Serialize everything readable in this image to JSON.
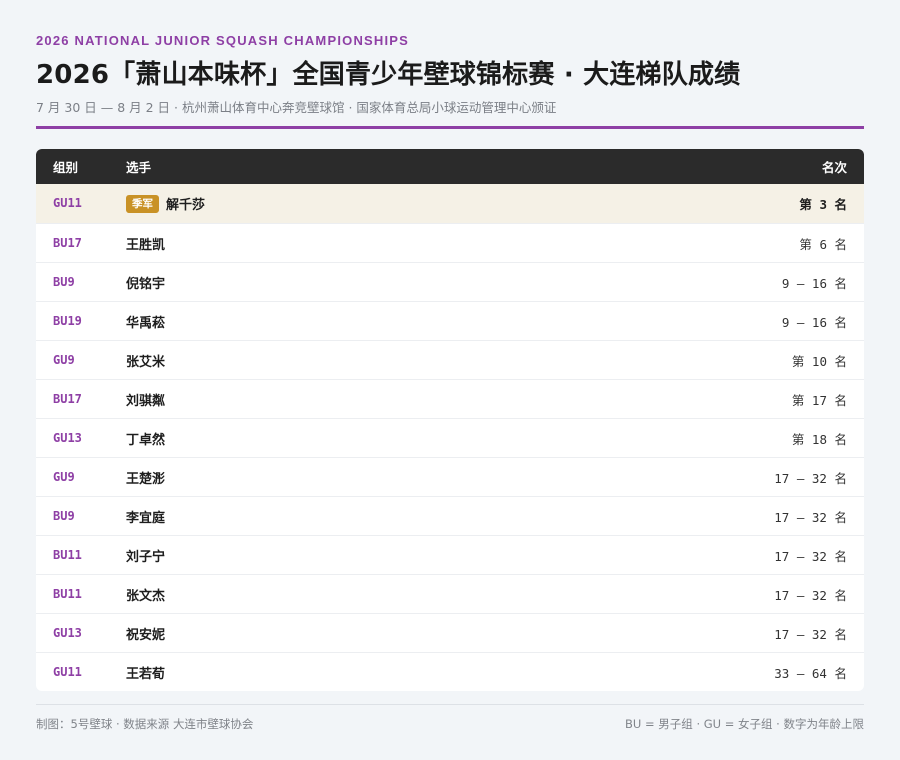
{
  "header": {
    "eyebrow": "2026 NATIONAL JUNIOR SQUASH CHAMPIONSHIPS",
    "title": "2026「萧山本味杯」全国青少年壁球锦标赛 · 大连梯队成绩",
    "subtitle": "7 月 30 日 — 8 月 2 日 · 杭州萧山体育中心奔竞壁球馆 · 国家体育总局小球运动管理中心颁证"
  },
  "table": {
    "columns": {
      "group": "组别",
      "player": "选手",
      "rank": "名次"
    },
    "rows": [
      {
        "group": "GU11",
        "badge": "季军",
        "player": "解千莎",
        "rank": "第 3 名",
        "highlight": true
      },
      {
        "group": "BU17",
        "badge": "",
        "player": "王胜凯",
        "rank": "第 6 名"
      },
      {
        "group": "BU9",
        "badge": "",
        "player": "倪铭宇",
        "rank": "9 — 16 名"
      },
      {
        "group": "BU19",
        "badge": "",
        "player": "华禹菘",
        "rank": "9 — 16 名"
      },
      {
        "group": "GU9",
        "badge": "",
        "player": "张艾米",
        "rank": "第 10 名"
      },
      {
        "group": "BU17",
        "badge": "",
        "player": "刘骐粼",
        "rank": "第 17 名"
      },
      {
        "group": "GU13",
        "badge": "",
        "player": "丁卓然",
        "rank": "第 18 名"
      },
      {
        "group": "GU9",
        "badge": "",
        "player": "王楚浵",
        "rank": "17 — 32 名"
      },
      {
        "group": "BU9",
        "badge": "",
        "player": "李宜庭",
        "rank": "17 — 32 名"
      },
      {
        "group": "BU11",
        "badge": "",
        "player": "刘子宁",
        "rank": "17 — 32 名"
      },
      {
        "group": "BU11",
        "badge": "",
        "player": "张文杰",
        "rank": "17 — 32 名"
      },
      {
        "group": "GU13",
        "badge": "",
        "player": "祝安妮",
        "rank": "17 — 32 名"
      },
      {
        "group": "GU11",
        "badge": "",
        "player": "王若荀",
        "rank": "33 — 64 名"
      }
    ]
  },
  "footer": {
    "credit": "制图：5号壁球 · 数据来源 大连市壁球协会",
    "legend": "BU = 男子组 · GU = 女子组 · 数字为年龄上限"
  },
  "colors": {
    "accent": "#8e3fa5",
    "badge": "#c99226",
    "header_bg": "#2b2b2b",
    "highlight_row": "#f5f1e6"
  }
}
